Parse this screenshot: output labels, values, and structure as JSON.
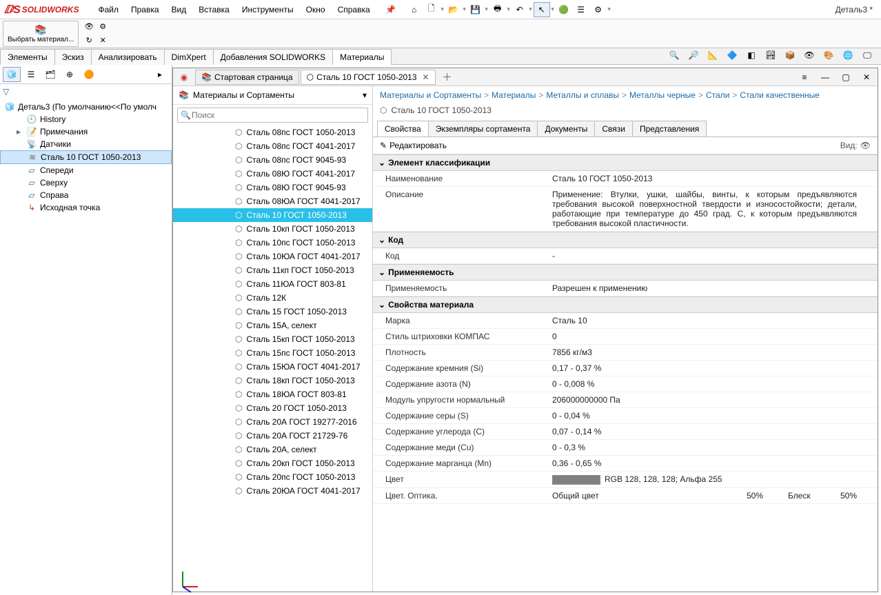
{
  "app": {
    "name": "SOLIDWORKS",
    "doc_label": "Деталь3 *"
  },
  "menu": [
    "Файл",
    "Правка",
    "Вид",
    "Вставка",
    "Инструменты",
    "Окно",
    "Справка"
  ],
  "ribbon": {
    "select_materials": "Выбрать материал..."
  },
  "tabs": [
    "Элементы",
    "Эскиз",
    "Анализировать",
    "DimXpert",
    "Добавления SOLIDWORKS",
    "Материалы"
  ],
  "active_tab": 5,
  "feature_tree": {
    "root": "Деталь3  (По умолчанию<<По умолч",
    "items": [
      {
        "icon": "history",
        "label": "History",
        "indent": 1
      },
      {
        "icon": "notes",
        "label": "Примечания",
        "indent": 1,
        "expander": "▸"
      },
      {
        "icon": "sensors",
        "label": "Датчики",
        "indent": 1
      },
      {
        "icon": "material",
        "label": "Сталь 10 ГОСТ 1050-2013",
        "indent": 1,
        "selected": true
      },
      {
        "icon": "plane",
        "label": "Спереди",
        "indent": 1
      },
      {
        "icon": "plane",
        "label": "Сверху",
        "indent": 1
      },
      {
        "icon": "plane",
        "label": "Справа",
        "indent": 1
      },
      {
        "icon": "origin",
        "label": "Исходная точка",
        "indent": 1
      }
    ]
  },
  "mat_panel": {
    "doc_tabs": [
      {
        "label": "Стартовая страница",
        "closable": false,
        "active": false
      },
      {
        "label": "Сталь 10 ГОСТ 1050-2013",
        "closable": true,
        "active": true
      }
    ],
    "tree_head": "Материалы и Сортаменты",
    "search_placeholder": "Поиск",
    "list": [
      "Сталь 08пс ГОСТ 1050-2013",
      "Сталь 08пс ГОСТ 4041-2017",
      "Сталь 08пс ГОСТ 9045-93",
      "Сталь 08Ю ГОСТ 4041-2017",
      "Сталь 08Ю ГОСТ 9045-93",
      "Сталь 08ЮА ГОСТ 4041-2017",
      "Сталь 10 ГОСТ 1050-2013",
      "Сталь 10кп ГОСТ 1050-2013",
      "Сталь 10пс ГОСТ 1050-2013",
      "Сталь 10ЮА ГОСТ 4041-2017",
      "Сталь 11кп ГОСТ 1050-2013",
      "Сталь 11ЮА ГОСТ 803-81",
      "Сталь 12К",
      "Сталь 15 ГОСТ 1050-2013",
      "Сталь 15А, селект",
      "Сталь 15кп ГОСТ 1050-2013",
      "Сталь 15пс ГОСТ 1050-2013",
      "Сталь 15ЮА ГОСТ 4041-2017",
      "Сталь 18кп ГОСТ 1050-2013",
      "Сталь 18ЮА ГОСТ 803-81",
      "Сталь 20 ГОСТ 1050-2013",
      "Сталь 20А ГОСТ 19277-2016",
      "Сталь 20А ГОСТ 21729-76",
      "Сталь 20А, селект",
      "Сталь 20кп ГОСТ 1050-2013",
      "Сталь 20пс ГОСТ 1050-2013",
      "Сталь 20ЮА ГОСТ 4041-2017"
    ],
    "selected_index": 6,
    "breadcrumb": [
      "Материалы и Сортаменты",
      "Материалы",
      "Металлы и сплавы",
      "Металлы черные",
      "Стали",
      "Стали качественные"
    ],
    "page_title": "Сталь 10 ГОСТ 1050-2013",
    "prop_tabs": [
      "Свойства",
      "Экземпляры сортамента",
      "Документы",
      "Связи",
      "Представления"
    ],
    "active_prop_tab": 0,
    "edit_label": "Редактировать",
    "view_label": "Вид:",
    "groups": [
      {
        "title": "Элемент классификации",
        "rows": [
          {
            "k": "Наименование",
            "v": "Сталь 10 ГОСТ 1050-2013"
          },
          {
            "k": "Описание",
            "v": "Применение: Втулки, ушки, шайбы, винты, к которым предъявляются требования высокой поверхностной твердости и износостойкости; детали, работающие при температуре до 450 град. С, к которым предъявляются требования высокой пластичности.",
            "justify": true
          }
        ]
      },
      {
        "title": "Код",
        "rows": [
          {
            "k": "Код",
            "v": "-"
          }
        ]
      },
      {
        "title": "Применяемость",
        "rows": [
          {
            "k": "Применяемость",
            "v": "Разрешен к применению"
          }
        ]
      },
      {
        "title": "Свойства материала",
        "rows": [
          {
            "k": "Марка",
            "v": "Сталь 10"
          },
          {
            "k": "Стиль штриховки КОМПАС",
            "v": "0"
          },
          {
            "k": "Плотность",
            "v": "7856   кг/м3"
          },
          {
            "k": "Содержание кремния (Si)",
            "v": "0,17  -  0,37   %"
          },
          {
            "k": "Содержание азота (N)",
            "v": "0  -  0,008   %"
          },
          {
            "k": "Модуль упругости нормальный",
            "v": "206000000000   Па"
          },
          {
            "k": "Содержание серы (S)",
            "v": "0  -  0,04   %"
          },
          {
            "k": "Содержание углерода (C)",
            "v": "0,07  -  0,14   %"
          },
          {
            "k": "Содержание меди (Cu)",
            "v": "0  -  0,3   %"
          },
          {
            "k": "Содержание марганца (Mn)",
            "v": "0,36  -  0,65   %"
          },
          {
            "k": "Цвет",
            "v": "RGB 128, 128, 128; Альфа 255",
            "swatch": true
          }
        ]
      },
      {
        "title": "__optics__",
        "rows": [
          {
            "k": "Цвет. Оптика.",
            "c1": "Общий цвет",
            "c2": "50%",
            "c3": "Блеск",
            "c4": "50%"
          }
        ]
      }
    ]
  }
}
